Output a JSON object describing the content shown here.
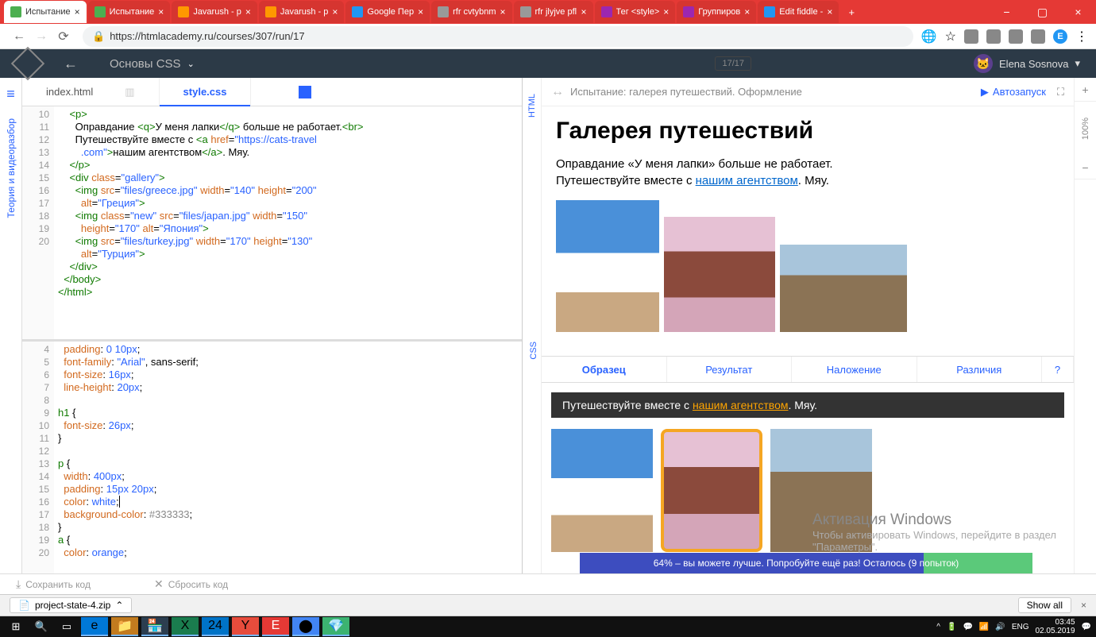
{
  "browser": {
    "tabs": [
      {
        "label": "Испытание"
      },
      {
        "label": "Испытание"
      },
      {
        "label": "Javarush - p"
      },
      {
        "label": "Javarush - p"
      },
      {
        "label": "Google Пер"
      },
      {
        "label": "rfr cvtybnm"
      },
      {
        "label": "rfr jlyjve pfl"
      },
      {
        "label": "Тег <style>"
      },
      {
        "label": "Группиров"
      },
      {
        "label": "Edit fiddle -"
      }
    ],
    "url": "https://htmlacademy.ru/courses/307/run/17",
    "user_initial": "E"
  },
  "app": {
    "course": "Основы CSS",
    "counter": "17/17",
    "user": "Elena Sosnova"
  },
  "files": {
    "t1": "index.html",
    "t2": "style.css"
  },
  "side_label": "Теория и видеоразбор",
  "vert_html": "HTML",
  "vert_css": "CSS",
  "gutter1": [
    "10",
    "11",
    "12",
    "",
    "13",
    "14",
    "15",
    "",
    "16",
    "",
    "17",
    "",
    "18",
    "19",
    "20"
  ],
  "gutter2": [
    "4",
    "5",
    "6",
    "7",
    "8",
    "9",
    "10",
    "11",
    "12",
    "13",
    "14",
    "15",
    "16",
    "17",
    "18",
    "19",
    "20"
  ],
  "preview": {
    "header": "Испытание: галерея путешествий. Оформление",
    "autoplay": "Автозапуск",
    "title": "Галерея путешествий",
    "p1a": "Оправдание «У меня лапки» больше не работает.",
    "p1b": "Путешествуйте вместе с ",
    "link": "нашим агентством",
    "p1c": ". Мяу."
  },
  "result_tabs": {
    "t1": "Образец",
    "t2": "Результат",
    "t3": "Наложение",
    "t4": "Различия",
    "q": "?"
  },
  "sample": {
    "text": "Путешествуйте вместе с ",
    "link": "нашим агентством",
    "tail": ". Мяу."
  },
  "zoom": {
    "plus": "+",
    "minus": "−",
    "pct": "100%"
  },
  "bottom": {
    "save": "Сохранить код",
    "reset": "Сбросить код"
  },
  "score": "64% – вы можете лучше. Попробуйте ещё раз!                Осталось (9 попыток)",
  "activation": {
    "title": "Активация Windows",
    "l1": "Чтобы активировать Windows, перейдите в раздел",
    "l2": "\"Параметры\"."
  },
  "dl": {
    "file": "project-state-4.zip",
    "show": "Show all"
  },
  "tray": {
    "lang": "ENG",
    "time": "03:45",
    "date": "02.05.2019"
  }
}
